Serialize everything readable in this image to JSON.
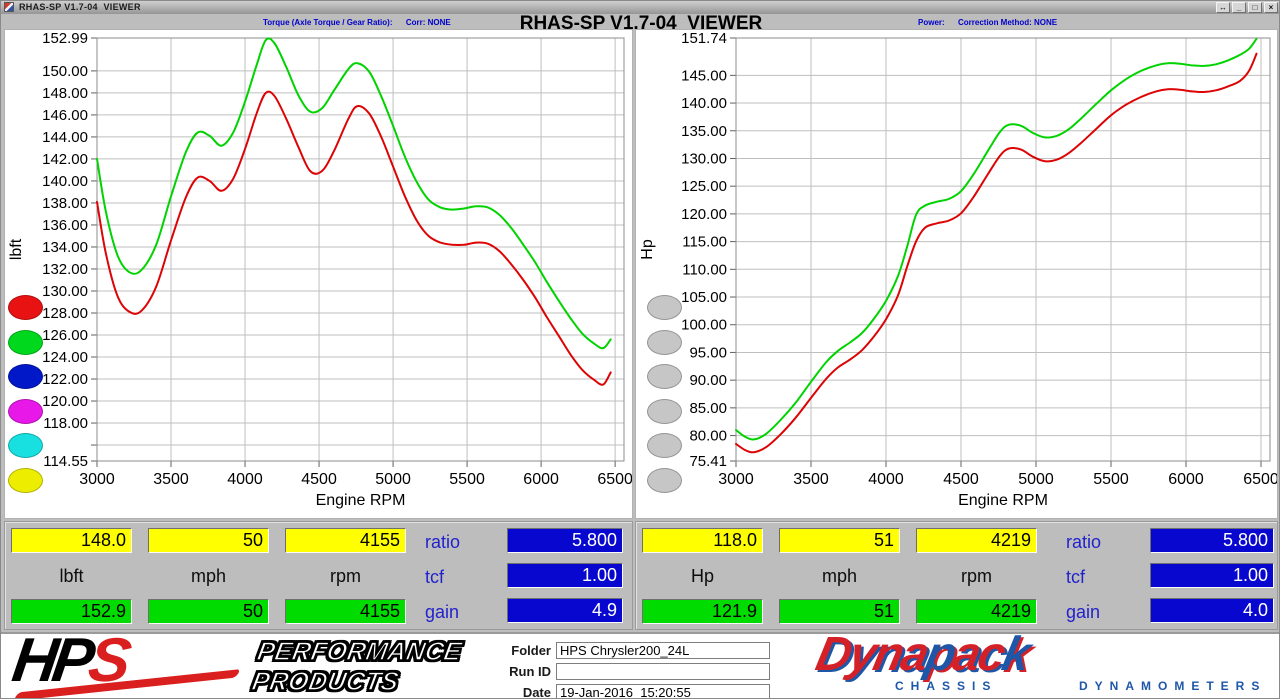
{
  "window": {
    "title": "RHAS-SP V1.7-04  VIEWER",
    "buttons": [
      "↔",
      "_",
      "□",
      "×"
    ]
  },
  "header": {
    "title": "RHAS-SP V1.7-04  VIEWER",
    "torque_caption": "Torque (Axle Torque / Gear Ratio):      Corr: NONE",
    "power_caption": "Power:      Correction Method: NONE"
  },
  "chart_data": [
    {
      "type": "line",
      "name": "torque-chart",
      "xlabel": "Engine RPM",
      "ylabel": "lbft",
      "xlim": [
        3000,
        6560
      ],
      "ylim": [
        114.55,
        152.99
      ],
      "grid": true,
      "xticks": [
        3000,
        3500,
        4000,
        4500,
        5000,
        5500,
        6000,
        6500
      ],
      "yticks": [
        [
          152.99,
          "152.99"
        ],
        [
          150,
          "150.00"
        ],
        [
          148,
          "148.00"
        ],
        [
          146,
          "146.00"
        ],
        [
          144,
          "144.00"
        ],
        [
          142,
          "142.00"
        ],
        [
          140,
          "140.00"
        ],
        [
          138,
          "138.00"
        ],
        [
          136,
          "136.00"
        ],
        [
          134,
          "134.00"
        ],
        [
          132,
          "132.00"
        ],
        [
          130,
          "130.00"
        ],
        [
          128,
          "128.00"
        ],
        [
          126,
          "126.00"
        ],
        [
          124,
          "124.00"
        ],
        [
          122,
          "122.00"
        ],
        [
          120,
          "120.00"
        ],
        [
          118,
          "118.00"
        ],
        [
          116,
          ""
        ],
        [
          114.55,
          "114.55"
        ]
      ],
      "series": [
        {
          "name": "torque-corrected-green",
          "color": "#00d300",
          "points": [
            [
              3000,
              142.0
            ],
            [
              3060,
              137.2
            ],
            [
              3140,
              133.2
            ],
            [
              3220,
              131.7
            ],
            [
              3300,
              131.9
            ],
            [
              3400,
              134.2
            ],
            [
              3500,
              138.6
            ],
            [
              3600,
              142.6
            ],
            [
              3680,
              144.4
            ],
            [
              3760,
              144.1
            ],
            [
              3840,
              143.2
            ],
            [
              3920,
              144.4
            ],
            [
              4000,
              147.2
            ],
            [
              4080,
              150.6
            ],
            [
              4140,
              152.8
            ],
            [
              4200,
              152.5
            ],
            [
              4280,
              150.3
            ],
            [
              4360,
              147.8
            ],
            [
              4440,
              146.3
            ],
            [
              4520,
              146.6
            ],
            [
              4600,
              148.2
            ],
            [
              4700,
              150.2
            ],
            [
              4760,
              150.7
            ],
            [
              4840,
              149.9
            ],
            [
              4920,
              147.7
            ],
            [
              5000,
              145.0
            ],
            [
              5080,
              142.2
            ],
            [
              5160,
              139.9
            ],
            [
              5240,
              138.3
            ],
            [
              5320,
              137.6
            ],
            [
              5400,
              137.4
            ],
            [
              5480,
              137.5
            ],
            [
              5560,
              137.7
            ],
            [
              5640,
              137.6
            ],
            [
              5720,
              136.9
            ],
            [
              5800,
              135.7
            ],
            [
              5880,
              134.2
            ],
            [
              5960,
              132.6
            ],
            [
              6040,
              130.8
            ],
            [
              6120,
              129.1
            ],
            [
              6200,
              127.5
            ],
            [
              6280,
              126.1
            ],
            [
              6360,
              125.2
            ],
            [
              6420,
              124.8
            ],
            [
              6470,
              125.6
            ]
          ]
        },
        {
          "name": "torque-measured-red",
          "color": "#dc0404",
          "points": [
            [
              3000,
              138.1
            ],
            [
              3060,
              133.4
            ],
            [
              3140,
              129.5
            ],
            [
              3220,
              128.1
            ],
            [
              3300,
              128.2
            ],
            [
              3400,
              130.4
            ],
            [
              3500,
              134.6
            ],
            [
              3600,
              138.5
            ],
            [
              3680,
              140.3
            ],
            [
              3760,
              140.0
            ],
            [
              3840,
              139.1
            ],
            [
              3920,
              140.2
            ],
            [
              4000,
              142.9
            ],
            [
              4080,
              146.2
            ],
            [
              4140,
              148.0
            ],
            [
              4200,
              147.7
            ],
            [
              4280,
              145.6
            ],
            [
              4360,
              143.1
            ],
            [
              4440,
              140.9
            ],
            [
              4520,
              140.9
            ],
            [
              4600,
              142.7
            ],
            [
              4700,
              145.7
            ],
            [
              4760,
              146.8
            ],
            [
              4840,
              146.1
            ],
            [
              4920,
              144.0
            ],
            [
              5000,
              141.3
            ],
            [
              5080,
              138.6
            ],
            [
              5160,
              136.4
            ],
            [
              5240,
              135.0
            ],
            [
              5320,
              134.4
            ],
            [
              5400,
              134.2
            ],
            [
              5480,
              134.2
            ],
            [
              5560,
              134.4
            ],
            [
              5640,
              134.3
            ],
            [
              5720,
              133.6
            ],
            [
              5800,
              132.4
            ],
            [
              5880,
              131.0
            ],
            [
              5960,
              129.4
            ],
            [
              6040,
              127.6
            ],
            [
              6120,
              125.9
            ],
            [
              6200,
              124.2
            ],
            [
              6280,
              122.8
            ],
            [
              6360,
              121.9
            ],
            [
              6420,
              121.5
            ],
            [
              6470,
              122.6
            ]
          ]
        }
      ]
    },
    {
      "type": "line",
      "name": "power-chart",
      "xlabel": "Engine RPM",
      "ylabel": "Hp",
      "xlim": [
        3000,
        6560
      ],
      "ylim": [
        75.41,
        151.74
      ],
      "grid": true,
      "xticks": [
        3000,
        3500,
        4000,
        4500,
        5000,
        5500,
        6000,
        6500
      ],
      "yticks": [
        [
          151.74,
          "151.74"
        ],
        [
          145,
          "145.00"
        ],
        [
          140,
          "140.00"
        ],
        [
          135,
          "135.00"
        ],
        [
          130,
          "130.00"
        ],
        [
          125,
          "125.00"
        ],
        [
          120,
          "120.00"
        ],
        [
          115,
          "115.00"
        ],
        [
          110,
          "110.00"
        ],
        [
          105,
          "105.00"
        ],
        [
          100,
          "100.00"
        ],
        [
          95,
          "95.00"
        ],
        [
          90,
          "90.00"
        ],
        [
          85,
          "85.00"
        ],
        [
          80,
          "80.00"
        ],
        [
          75.41,
          "75.41"
        ]
      ],
      "series": [
        {
          "name": "power-corrected-green",
          "color": "#00d300",
          "points": [
            [
              3000,
              81.0
            ],
            [
              3060,
              79.8
            ],
            [
              3120,
              79.3
            ],
            [
              3200,
              80.3
            ],
            [
              3300,
              82.9
            ],
            [
              3400,
              86.0
            ],
            [
              3500,
              89.7
            ],
            [
              3600,
              93.2
            ],
            [
              3680,
              95.3
            ],
            [
              3760,
              96.8
            ],
            [
              3840,
              98.5
            ],
            [
              3920,
              101.1
            ],
            [
              4000,
              104.3
            ],
            [
              4080,
              108.8
            ],
            [
              4140,
              114.0
            ],
            [
              4200,
              119.8
            ],
            [
              4260,
              121.5
            ],
            [
              4340,
              122.2
            ],
            [
              4420,
              122.7
            ],
            [
              4500,
              124.1
            ],
            [
              4580,
              127.0
            ],
            [
              4680,
              131.4
            ],
            [
              4760,
              134.8
            ],
            [
              4820,
              136.1
            ],
            [
              4900,
              135.9
            ],
            [
              4980,
              134.6
            ],
            [
              5060,
              133.8
            ],
            [
              5140,
              134.1
            ],
            [
              5220,
              135.3
            ],
            [
              5300,
              137.2
            ],
            [
              5400,
              139.8
            ],
            [
              5500,
              142.3
            ],
            [
              5600,
              144.3
            ],
            [
              5700,
              145.8
            ],
            [
              5800,
              146.8
            ],
            [
              5880,
              147.2
            ],
            [
              5960,
              147.1
            ],
            [
              6040,
              146.8
            ],
            [
              6120,
              146.7
            ],
            [
              6200,
              147.0
            ],
            [
              6280,
              147.7
            ],
            [
              6360,
              148.7
            ],
            [
              6420,
              149.8
            ],
            [
              6470,
              151.6
            ]
          ]
        },
        {
          "name": "power-measured-red",
          "color": "#dc0404",
          "points": [
            [
              3000,
              78.5
            ],
            [
              3060,
              77.4
            ],
            [
              3120,
              77.0
            ],
            [
              3200,
              77.9
            ],
            [
              3300,
              80.3
            ],
            [
              3400,
              83.3
            ],
            [
              3500,
              86.8
            ],
            [
              3600,
              90.2
            ],
            [
              3680,
              92.3
            ],
            [
              3760,
              93.7
            ],
            [
              3840,
              95.4
            ],
            [
              3920,
              97.9
            ],
            [
              4000,
              101.0
            ],
            [
              4080,
              105.3
            ],
            [
              4140,
              110.4
            ],
            [
              4200,
              115.0
            ],
            [
              4260,
              117.5
            ],
            [
              4340,
              118.3
            ],
            [
              4420,
              118.8
            ],
            [
              4500,
              120.1
            ],
            [
              4580,
              122.9
            ],
            [
              4680,
              127.2
            ],
            [
              4760,
              130.5
            ],
            [
              4820,
              131.8
            ],
            [
              4900,
              131.6
            ],
            [
              4980,
              130.3
            ],
            [
              5060,
              129.5
            ],
            [
              5140,
              129.8
            ],
            [
              5220,
              131.0
            ],
            [
              5300,
              132.8
            ],
            [
              5400,
              135.3
            ],
            [
              5500,
              137.8
            ],
            [
              5600,
              139.7
            ],
            [
              5700,
              141.1
            ],
            [
              5800,
              142.1
            ],
            [
              5880,
              142.5
            ],
            [
              5960,
              142.4
            ],
            [
              6040,
              142.1
            ],
            [
              6120,
              142.0
            ],
            [
              6200,
              142.3
            ],
            [
              6280,
              143.0
            ],
            [
              6360,
              144.0
            ],
            [
              6420,
              145.8
            ],
            [
              6470,
              148.9
            ]
          ]
        }
      ]
    }
  ],
  "legend": {
    "left": [
      {
        "name": "red",
        "color": "#e81212",
        "enabled": true
      },
      {
        "name": "green",
        "color": "#00d81e",
        "enabled": true
      },
      {
        "name": "blue",
        "color": "#0018c8",
        "enabled": true
      },
      {
        "name": "magenta",
        "color": "#e818e8",
        "enabled": true
      },
      {
        "name": "cyan",
        "color": "#18e0e0",
        "enabled": true
      },
      {
        "name": "yellow",
        "color": "#eded00",
        "enabled": true
      }
    ],
    "right": [
      {
        "name": "gray-1",
        "color": "#c6c6c6",
        "enabled": false
      },
      {
        "name": "gray-2",
        "color": "#c6c6c6",
        "enabled": false
      },
      {
        "name": "gray-3",
        "color": "#c6c6c6",
        "enabled": false
      },
      {
        "name": "gray-4",
        "color": "#c6c6c6",
        "enabled": false
      },
      {
        "name": "gray-5",
        "color": "#c6c6c6",
        "enabled": false
      },
      {
        "name": "gray-6",
        "color": "#c6c6c6",
        "enabled": false
      }
    ]
  },
  "readouts": [
    {
      "cursor": [
        "148.0",
        "50",
        "4155"
      ],
      "units": [
        "lbft",
        "mph",
        "rpm"
      ],
      "run": [
        "152.9",
        "50",
        "4155"
      ],
      "ratio_label": "ratio",
      "ratio": "5.800",
      "tcf_label": "tcf",
      "tcf": "1.00",
      "gain_label": "gain",
      "gain": "4.9"
    },
    {
      "cursor": [
        "118.0",
        "51",
        "4219"
      ],
      "units": [
        "Hp",
        "mph",
        "rpm"
      ],
      "run": [
        "121.9",
        "51",
        "4219"
      ],
      "ratio_label": "ratio",
      "ratio": "5.800",
      "tcf_label": "tcf",
      "tcf": "1.00",
      "gain_label": "gain",
      "gain": "4.0"
    }
  ],
  "footer": {
    "hps": {
      "hp": "HP",
      "s": "S",
      "line1": "PERFORMANCE",
      "line2": "PRODUCTS"
    },
    "fields": [
      {
        "label": "Folder",
        "value": "HPS Chrysler200_24L"
      },
      {
        "label": "Run ID",
        "value": ""
      },
      {
        "label": "Date",
        "value": "19-Jan-2016  15:20:55"
      }
    ],
    "dynapack": {
      "letters": [
        [
          "D",
          "r"
        ],
        [
          "y",
          "r"
        ],
        [
          "n",
          "r"
        ],
        [
          "a",
          "r"
        ],
        [
          "p",
          "b"
        ],
        [
          "a",
          "r"
        ],
        [
          "c",
          "r"
        ],
        [
          "k",
          "b"
        ]
      ],
      "sub_left": "CHASSIS",
      "sub_right": "DYNAMOMETERS"
    }
  }
}
